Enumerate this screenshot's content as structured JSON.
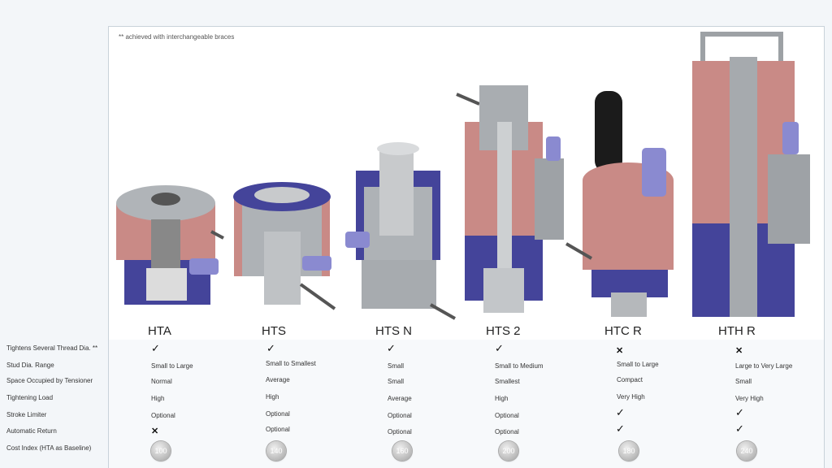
{
  "note": "** achieved with interchangeable braces",
  "products": [
    "HTA",
    "HTS",
    "HTS N",
    "HTS 2",
    "HTC R",
    "HTH R"
  ],
  "rows": [
    {
      "label": "Tightens Several  Thread Dia. **"
    },
    {
      "label": "Stud Dia. Range"
    },
    {
      "label": "Space Occupied by Tensioner"
    },
    {
      "label": "Tightening Load"
    },
    {
      "label": "Stroke Limiter"
    },
    {
      "label": "Automatic Return"
    },
    {
      "label": "Cost Index (HTA as Baseline)"
    }
  ],
  "cells": {
    "stud": [
      "Small to Large",
      "Small to Smallest",
      "Small",
      "Small to Medium",
      "Small to Large",
      "Large to Very Large"
    ],
    "space": [
      "Normal",
      "Average",
      "Small",
      "Smallest",
      "Compact",
      "Small"
    ],
    "load": [
      "High",
      "High",
      "Average",
      "High",
      "Very High",
      "Very High"
    ],
    "stroke": [
      "Optional",
      "Optional",
      "Optional",
      "Optional"
    ],
    "autoreturn": [
      "Optional",
      "Optional",
      "Optional"
    ],
    "cost": [
      "100",
      "140",
      "160",
      "200",
      "180",
      "240"
    ]
  },
  "icons": {
    "check": "check-icon",
    "cross": "cross-icon"
  },
  "colors": {
    "body_pink": "#c98a86",
    "body_blue": "#44449a",
    "steel": "#a8acb0",
    "dark_steel": "#6f7377"
  }
}
